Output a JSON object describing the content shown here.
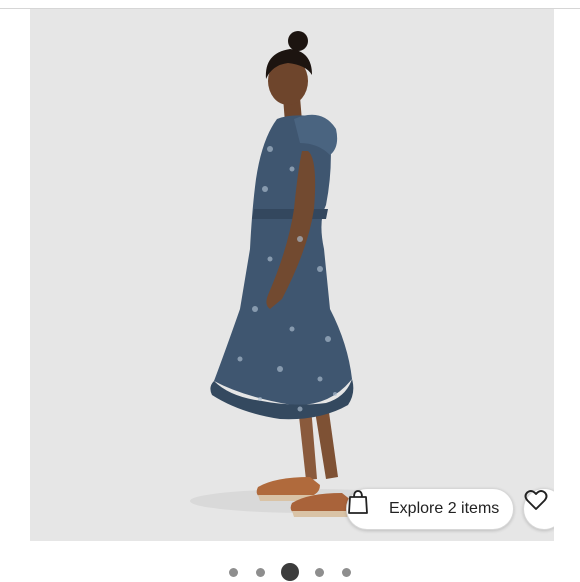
{
  "carousel": {
    "image": {
      "subject": "model-wearing-blue-floral-midi-dress"
    },
    "explore_button": {
      "label": "Explore 2 items",
      "icon": "shopping-bag-icon"
    },
    "like_button": {
      "icon": "heart-icon"
    },
    "pagination": {
      "total": 5,
      "active_index": 2
    }
  },
  "colors": {
    "background": "#e6e6e6",
    "dress": "#3f5670",
    "dot_active": "#3c3c3c",
    "dot_inactive": "#8e8e8e"
  }
}
